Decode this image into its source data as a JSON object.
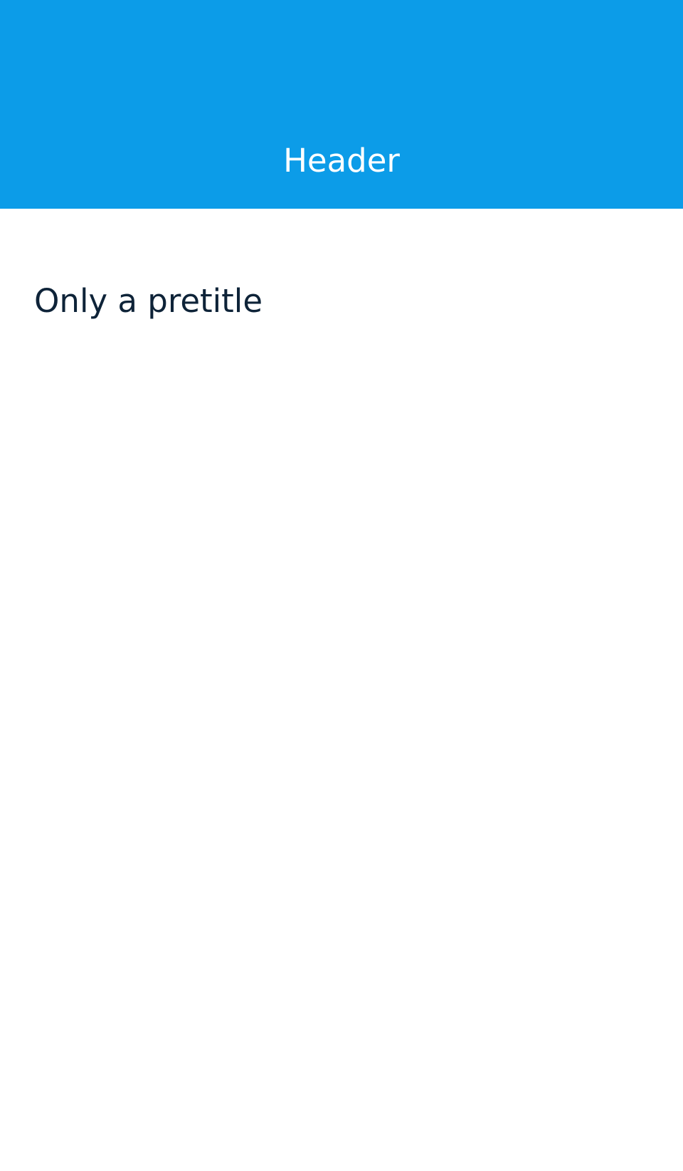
{
  "header": {
    "title": "Header",
    "background_color": "#0c9ce8",
    "text_color": "#ffffff"
  },
  "content": {
    "pretitle": "Only a pretitle",
    "text_color": "#0e2338",
    "background_color": "#ffffff"
  }
}
